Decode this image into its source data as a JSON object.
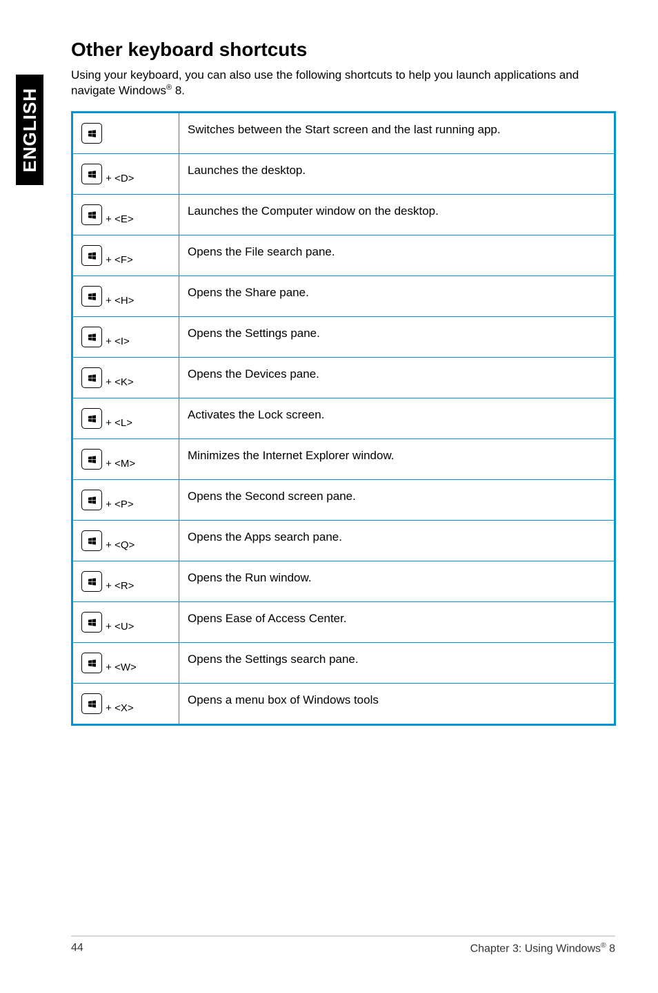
{
  "sideTab": "ENGLISH",
  "title": "Other keyboard shortcuts",
  "intro_a": "Using your keyboard, you can also use the following shortcuts to help you launch applications and navigate Windows",
  "intro_b": " 8.",
  "rows": [
    {
      "suffix": "",
      "desc": "Switches between the Start screen and the last running app.",
      "cls": ""
    },
    {
      "suffix": " + <D>",
      "desc": "Launches the desktop.",
      "cls": "med"
    },
    {
      "suffix": " + <E>",
      "desc": "Launches the Computer window on the desktop.",
      "cls": "tall"
    },
    {
      "suffix": " + <F>",
      "desc": "Opens the File search pane.",
      "cls": "med"
    },
    {
      "suffix": " + <H>",
      "desc": "Opens the Share pane.",
      "cls": ""
    },
    {
      "suffix": " + <I>",
      "desc": "Opens the Settings pane.",
      "cls": "med"
    },
    {
      "suffix": " + <K>",
      "desc": "Opens the Devices pane.",
      "cls": "med"
    },
    {
      "suffix": " + <L>",
      "desc": "Activates the Lock screen.",
      "cls": "med"
    },
    {
      "suffix": " + <M>",
      "desc": "Minimizes the Internet Explorer window.",
      "cls": ""
    },
    {
      "suffix": " + <P>",
      "desc": "Opens the Second screen pane.",
      "cls": "med"
    },
    {
      "suffix": " + <Q>",
      "desc": "Opens the Apps search pane.",
      "cls": "tall"
    },
    {
      "suffix": " + <R>",
      "desc": "Opens the Run window.",
      "cls": "med"
    },
    {
      "suffix": " + <U>",
      "desc": "Opens Ease of Access Center.",
      "cls": "med"
    },
    {
      "suffix": " + <W>",
      "desc": "Opens the Settings search pane.",
      "cls": "med"
    },
    {
      "suffix": " + <X>",
      "desc": "Opens a menu box of Windows tools",
      "cls": "med"
    }
  ],
  "footer": {
    "page": "44",
    "chapter_a": "Chapter 3: Using Windows",
    "chapter_b": " 8"
  }
}
